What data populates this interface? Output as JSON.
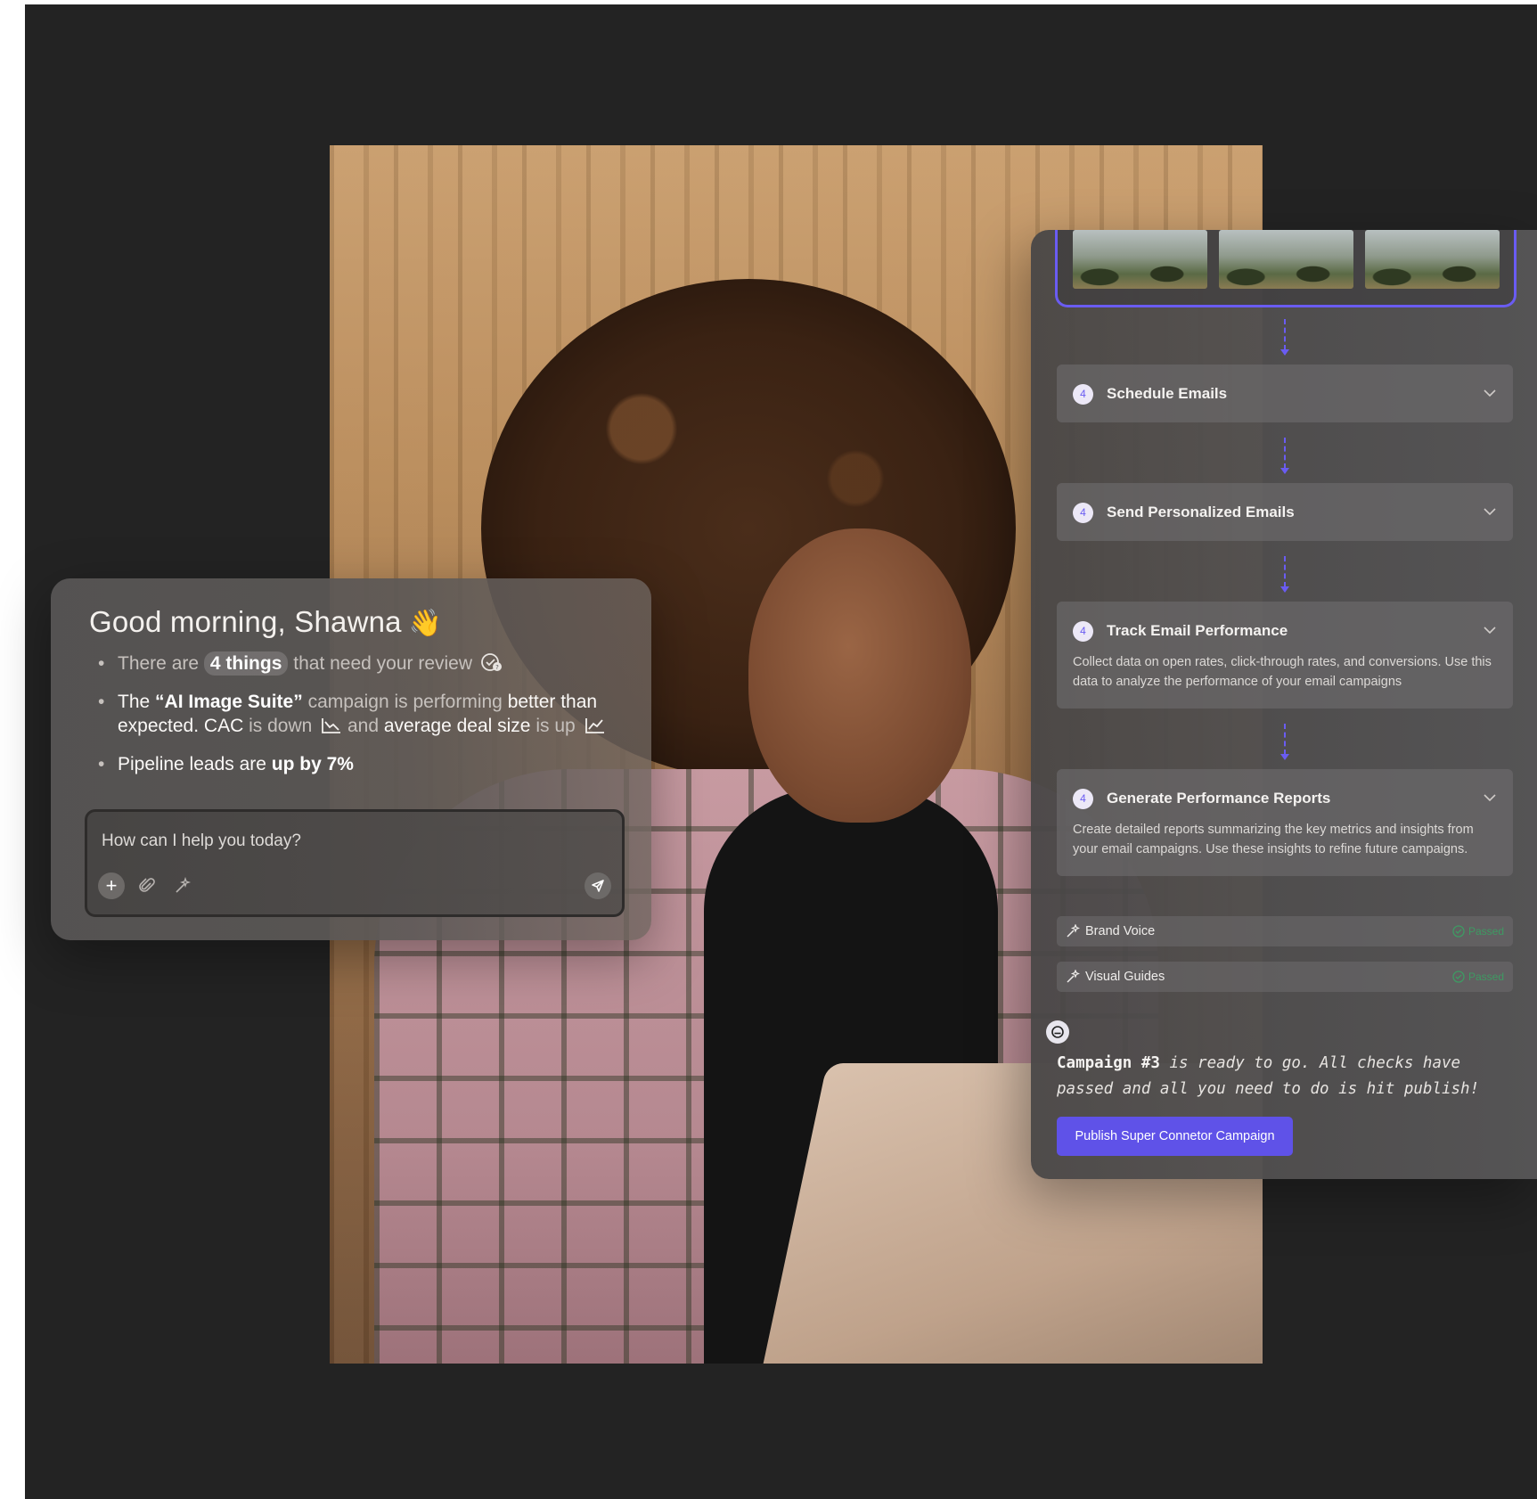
{
  "greeting": {
    "title": "Good morning, Shawna",
    "emoji": "👋"
  },
  "summary": {
    "bullet1": {
      "before": "There are",
      "highlight": "4 things",
      "after": "that need your review"
    },
    "bullet2": {
      "the": "The",
      "campaign_name": "“AI Image Suite”",
      "mid1": "campaign is performing",
      "better": "better than expected. CAC",
      "is_down": "is down",
      "and": "and",
      "deal_size": "average deal size",
      "is_up": "is up"
    },
    "bullet3": {
      "before": "Pipeline leads are",
      "bold": "up by 7%"
    }
  },
  "chat_input": {
    "placeholder": "How can I help you today?",
    "add_symbol": "+"
  },
  "workflow": {
    "steps": [
      {
        "number": "4",
        "title": "Schedule Emails",
        "description": ""
      },
      {
        "number": "4",
        "title": "Send Personalized Emails",
        "description": ""
      },
      {
        "number": "4",
        "title": "Track Email Performance",
        "description": "Collect data on open rates, click-through rates, and conversions. Use this data to analyze the performance of your email campaigns"
      },
      {
        "number": "4",
        "title": "Generate Performance Reports",
        "description": "Create detailed reports summarizing the key metrics and insights from your email campaigns. Use these insights to refine future campaigns."
      }
    ],
    "checks": [
      {
        "label": "Brand Voice",
        "status": "Passed"
      },
      {
        "label": "Visual Guides",
        "status": "Passed"
      }
    ],
    "message": {
      "bold": "Campaign #3",
      "rest": "is ready to go. All checks have passed and all you need to do is hit publish!"
    },
    "publish_label": "Publish Super Connetor Campaign"
  },
  "colors": {
    "accent": "#6a5cf2",
    "publish_button": "#5f52e8",
    "passed": "#3e9a63",
    "canvas": "#232323"
  },
  "icons": {
    "greeting": "waving-hand-icon",
    "review": "check-badge-icon",
    "trend_down": "trend-down-icon",
    "trend_up": "trend-up-icon",
    "attach": "paperclip-icon",
    "magic": "magic-wand-icon",
    "send": "send-icon",
    "step_expand": "chevron-down-icon",
    "check": "check-circle-icon",
    "bot": "bot-avatar-icon"
  }
}
